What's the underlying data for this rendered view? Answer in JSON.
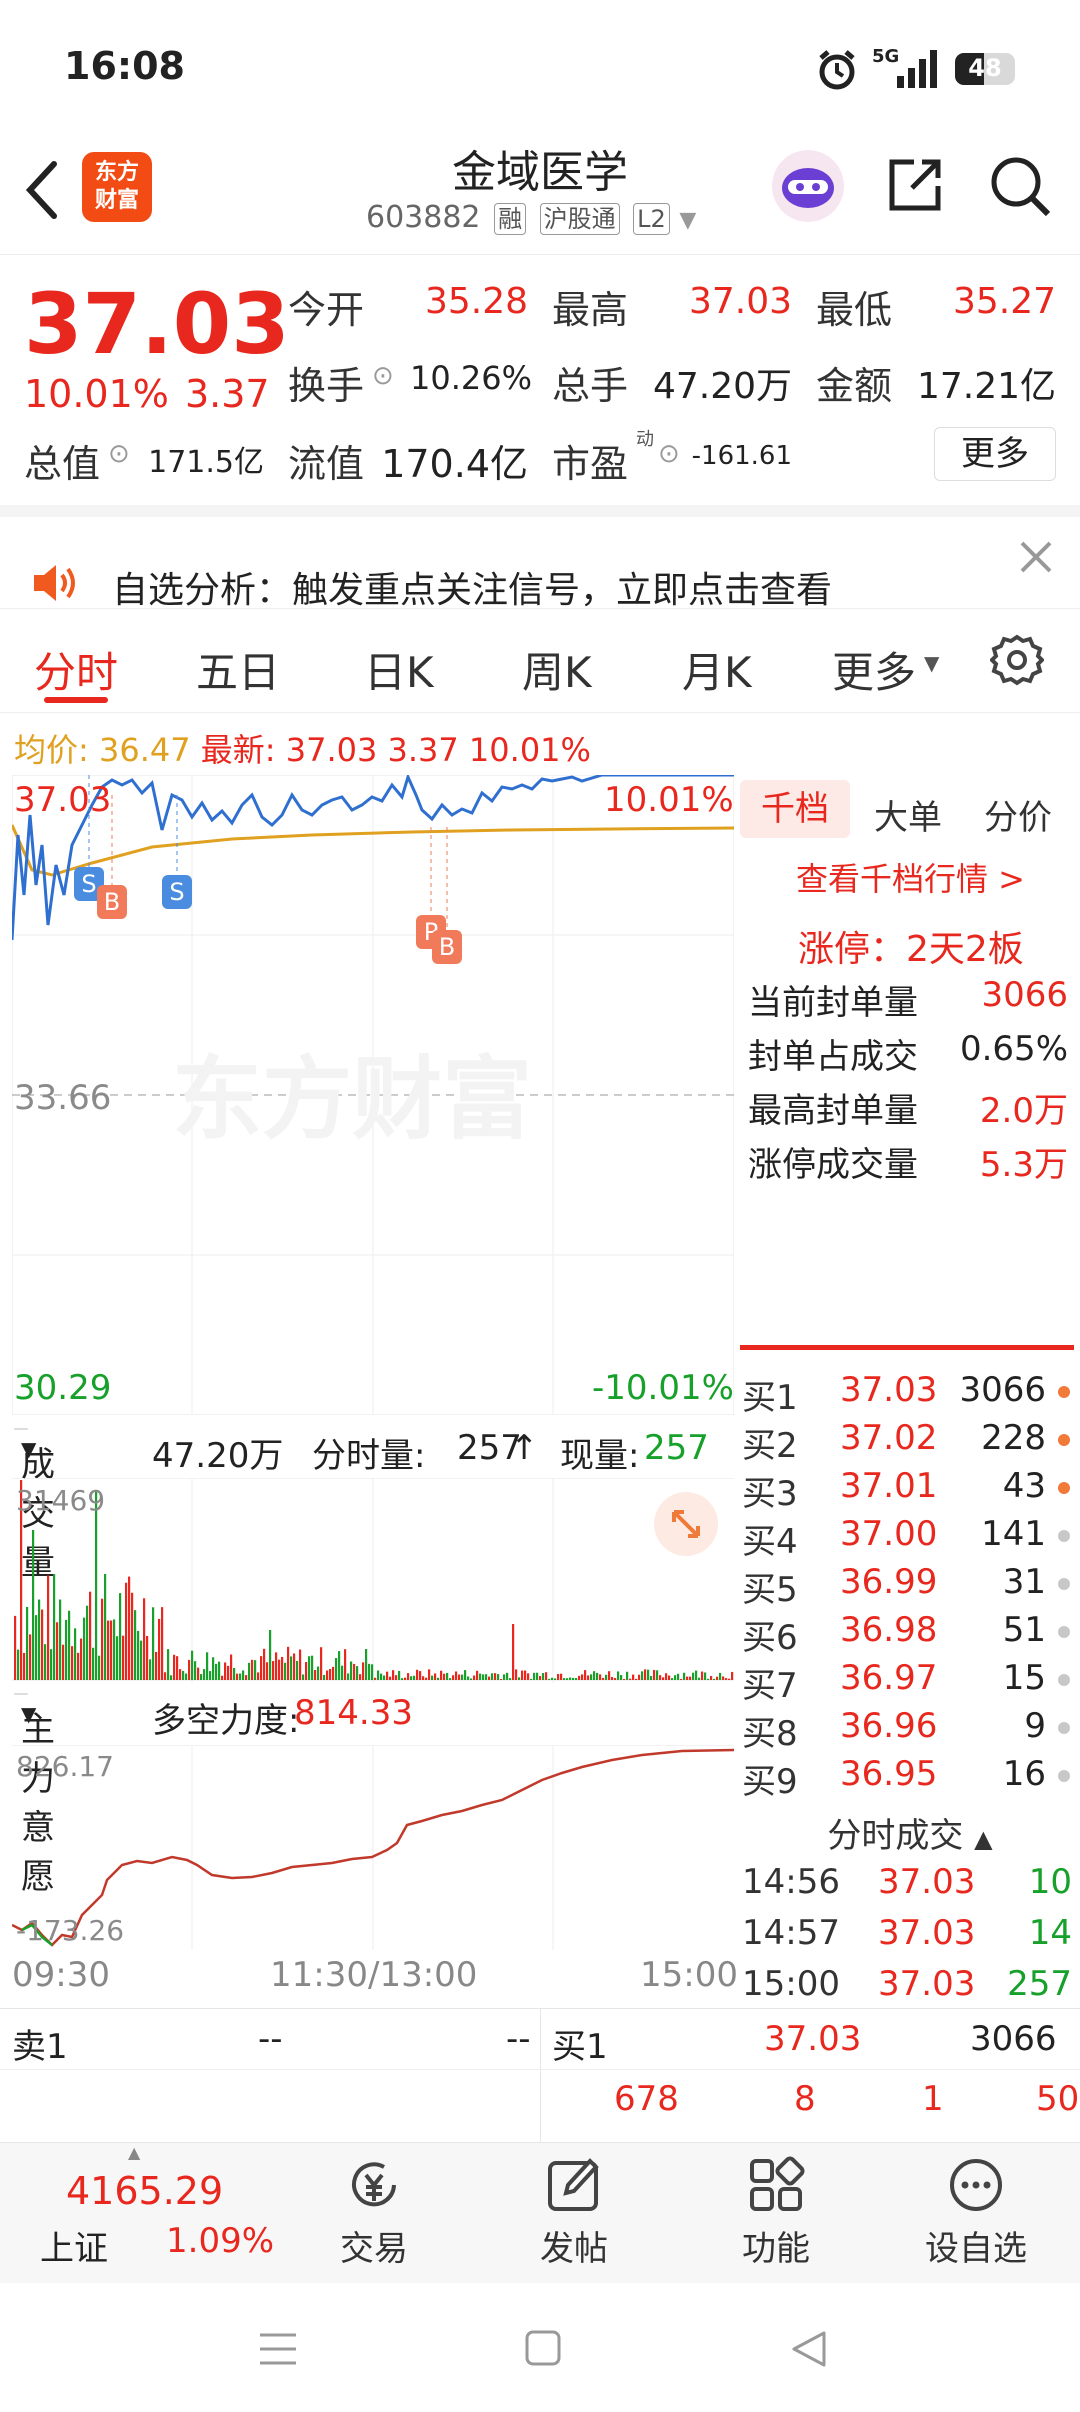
{
  "status": {
    "time": "16:08",
    "network": "5G",
    "battery": "48",
    "battery_level": 0.48
  },
  "header": {
    "logo_line1": "东方",
    "logo_line2": "财富",
    "stock_name": "金域医学",
    "stock_code": "603882",
    "tags": [
      "融",
      "沪股通",
      "L2"
    ]
  },
  "quote": {
    "price": "37.03",
    "change_pct": "10.01%",
    "change": "3.37",
    "open_label": "今开",
    "open": "35.28",
    "high_label": "最高",
    "high": "37.03",
    "low_label": "最低",
    "low": "35.27",
    "turnover_label": "换手",
    "turnover": "10.26%",
    "volume_label": "总手",
    "volume": "47.20万",
    "amount_label": "金额",
    "amount": "17.21亿",
    "mktcap_label": "总值",
    "mktcap": "171.5亿",
    "float_label": "流值",
    "float": "170.4亿",
    "pe_label": "市盈",
    "pe_sup": "动",
    "pe": "-161.61",
    "more": "更多"
  },
  "banner": {
    "text": "自选分析：触发重点关注信号，立即点击查看"
  },
  "tabs": [
    "分时",
    "五日",
    "日K",
    "周K",
    "月K",
    "更多"
  ],
  "avg_line": {
    "avg_label": "均价:",
    "avg": "36.47",
    "latest_label": "最新:",
    "latest": "37.03",
    "change": "3.37",
    "pct": "10.01%"
  },
  "price_chart": {
    "top_price": "37.03",
    "top_pct": "10.01%",
    "mid_price": "33.66",
    "bottom_price": "30.29",
    "bottom_pct": "-10.01%",
    "watermark": "东方财富",
    "markers": [
      "S",
      "B",
      "S",
      "P",
      "B"
    ]
  },
  "right_panel": {
    "tabs": [
      "千档",
      "大单",
      "分价"
    ],
    "link": "查看千档行情 >",
    "limit_up": "涨停：2天2板",
    "rows": [
      {
        "label": "当前封单量",
        "value": "3066"
      },
      {
        "label": "封单占成交",
        "value": "0.65%"
      },
      {
        "label": "最高封单量",
        "value": "2.0万"
      },
      {
        "label": "涨停成交量",
        "value": "5.3万"
      }
    ]
  },
  "order_book": [
    {
      "label": "买1",
      "price": "37.03",
      "qty": "3066",
      "dot": "#f07a3a"
    },
    {
      "label": "买2",
      "price": "37.02",
      "qty": "228",
      "dot": "#f07a3a"
    },
    {
      "label": "买3",
      "price": "37.01",
      "qty": "43",
      "dot": "#f07a3a"
    },
    {
      "label": "买4",
      "price": "37.00",
      "qty": "141",
      "dot": "#c8c8c8"
    },
    {
      "label": "买5",
      "price": "36.99",
      "qty": "31",
      "dot": "#c8c8c8"
    },
    {
      "label": "买6",
      "price": "36.98",
      "qty": "51",
      "dot": "#c8c8c8"
    },
    {
      "label": "买7",
      "price": "36.97",
      "qty": "15",
      "dot": "#c8c8c8"
    },
    {
      "label": "买8",
      "price": "36.96",
      "qty": "9",
      "dot": "#c8c8c8"
    },
    {
      "label": "买9",
      "price": "36.95",
      "qty": "16",
      "dot": "#c8c8c8"
    }
  ],
  "volume": {
    "label": "成交量",
    "total": "47.20万",
    "minute_label": "分时量:",
    "minute": "257",
    "arrow": "↑",
    "now_label": "现量:",
    "now": "257",
    "max": "31469"
  },
  "main_force": {
    "label": "主力意愿",
    "power_label": "多空力度:",
    "power": "814.33",
    "max": "826.17",
    "min": "-173.26"
  },
  "time_axis": [
    "09:30",
    "11:30/13:00",
    "15:00"
  ],
  "trades": {
    "title": "分时成交",
    "rows": [
      {
        "time": "14:56",
        "price": "37.03",
        "qty": "10"
      },
      {
        "time": "14:57",
        "price": "37.03",
        "qty": "14"
      },
      {
        "time": "15:00",
        "price": "37.03",
        "qty": "257"
      }
    ]
  },
  "strip": {
    "sell_label": "卖1",
    "sell_price": "--",
    "sell_qty": "--",
    "buy_label": "买1",
    "buy_price": "37.03",
    "buy_qty": "3066",
    "n1": "678",
    "n2": "8",
    "n3": "1",
    "n4": "50"
  },
  "nav": {
    "index_value": "4165.29",
    "index_name": "上证",
    "index_pct": "1.09%",
    "items": [
      "交易",
      "发帖",
      "功能",
      "设自选"
    ]
  }
}
